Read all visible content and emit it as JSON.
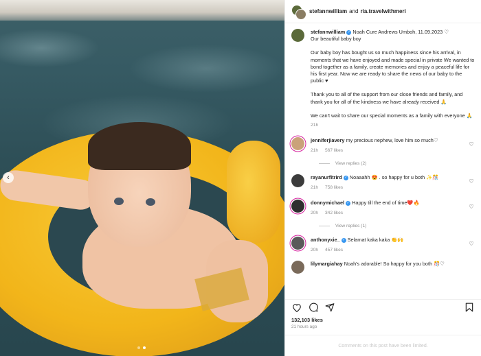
{
  "post": {
    "header": {
      "author": "stefannwilliam",
      "connector": "and",
      "collaborator": "ria.travelwithmeri"
    },
    "caption": {
      "author": "stefannwilliam",
      "headline": "Noah Cure Andrews Umboh, 11.09.2023 ♡",
      "line2": "Our beautiful baby boy",
      "paragraph1": "Our baby boy has bought us so much happiness since his arrival, in moments that we have enjoyed and made special in private We wanted to bond together as a family, create memories and enjoy a peaceful life for his first year. Now we are ready to share the news of our baby to the public ♥",
      "paragraph2": "Thank you to all of the support from our close friends and family, and thank you for all of the kindness we have already received 🙏",
      "paragraph3": "We can't wait to share our special moments as a family with everyone 🙏",
      "time": "21h"
    },
    "comments": [
      {
        "user": "jenniferjiavery",
        "verified": false,
        "text": "my precious nephew, love him so much♡",
        "time": "21h",
        "likes": "567 likes",
        "replies": "View replies (2)",
        "avatar_color": "#caa27a"
      },
      {
        "user": "rayanurfitrird",
        "verified": true,
        "text": "Noaaahh 😍 . so happy for u both ✨🎊",
        "time": "21h",
        "likes": "758 likes",
        "replies": "",
        "avatar_color": "#3c3c3c"
      },
      {
        "user": "donnymichael",
        "verified": true,
        "text": "Happy till the end of time❤️🔥",
        "time": "20h",
        "likes": "342 likes",
        "replies": "View replies (1)",
        "avatar_color": "#2f2f2f"
      },
      {
        "user": "anthonyxie_",
        "verified": true,
        "text": "Selamat kaka kaka 👏🙌",
        "time": "20h",
        "likes": "457 likes",
        "replies": "",
        "avatar_color": "#5a5a5a"
      },
      {
        "user": "lilymargiahay",
        "verified": false,
        "text": "Noah's adorable! So happy for you both 🎊♡",
        "time": "",
        "likes": "",
        "replies": "",
        "avatar_color": "#7a6a5a"
      }
    ],
    "actions": {
      "like_icon": "heart-icon",
      "comment_icon": "comment-icon",
      "share_icon": "share-icon",
      "save_icon": "bookmark-icon"
    },
    "likes": "132,103 likes",
    "posted": "21 hours ago",
    "comments_limited": "Comments on this post have been limited.",
    "carousel": {
      "prev_icon": "chevron-left-icon",
      "total": 2,
      "active": 1
    }
  }
}
